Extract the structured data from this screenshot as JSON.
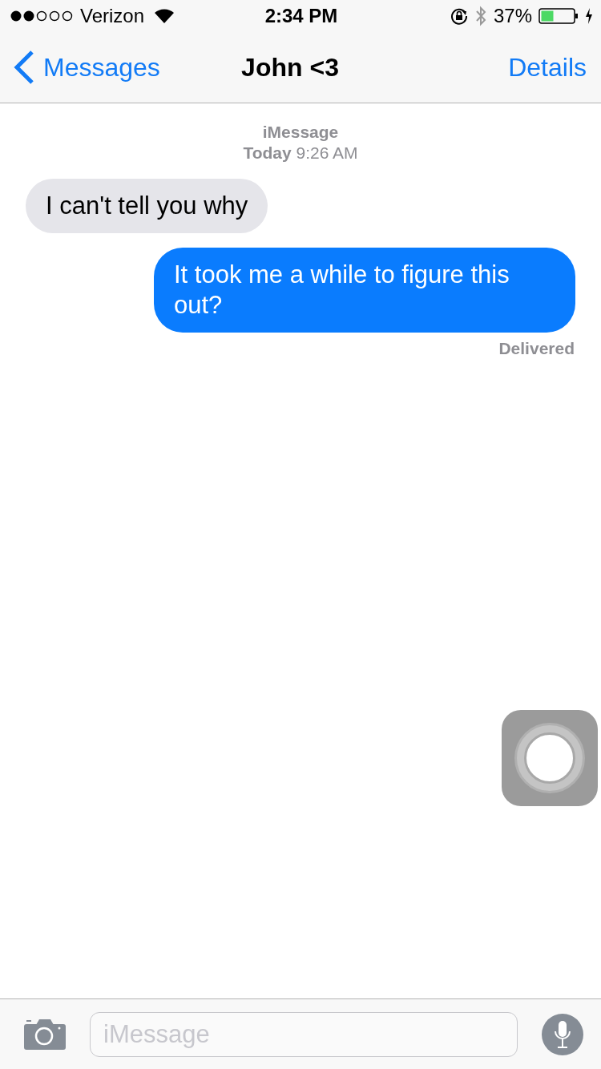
{
  "status_bar": {
    "carrier": "Verizon",
    "time": "2:34 PM",
    "battery_percent": "37%",
    "charging": true
  },
  "nav_bar": {
    "back_label": "Messages",
    "title": "John <3",
    "action": "Details"
  },
  "conversation": {
    "service": "iMessage",
    "timestamp": "**Today** 9:26 AM",
    "messages": [
      {
        "kind": "incoming",
        "text": "I can't tell you why"
      },
      {
        "kind": "outgoing",
        "text": "It took me a while to figure this out?"
      }
    ],
    "receipt": "Delivered"
  },
  "compose": {
    "placeholder": "iMessage"
  }
}
